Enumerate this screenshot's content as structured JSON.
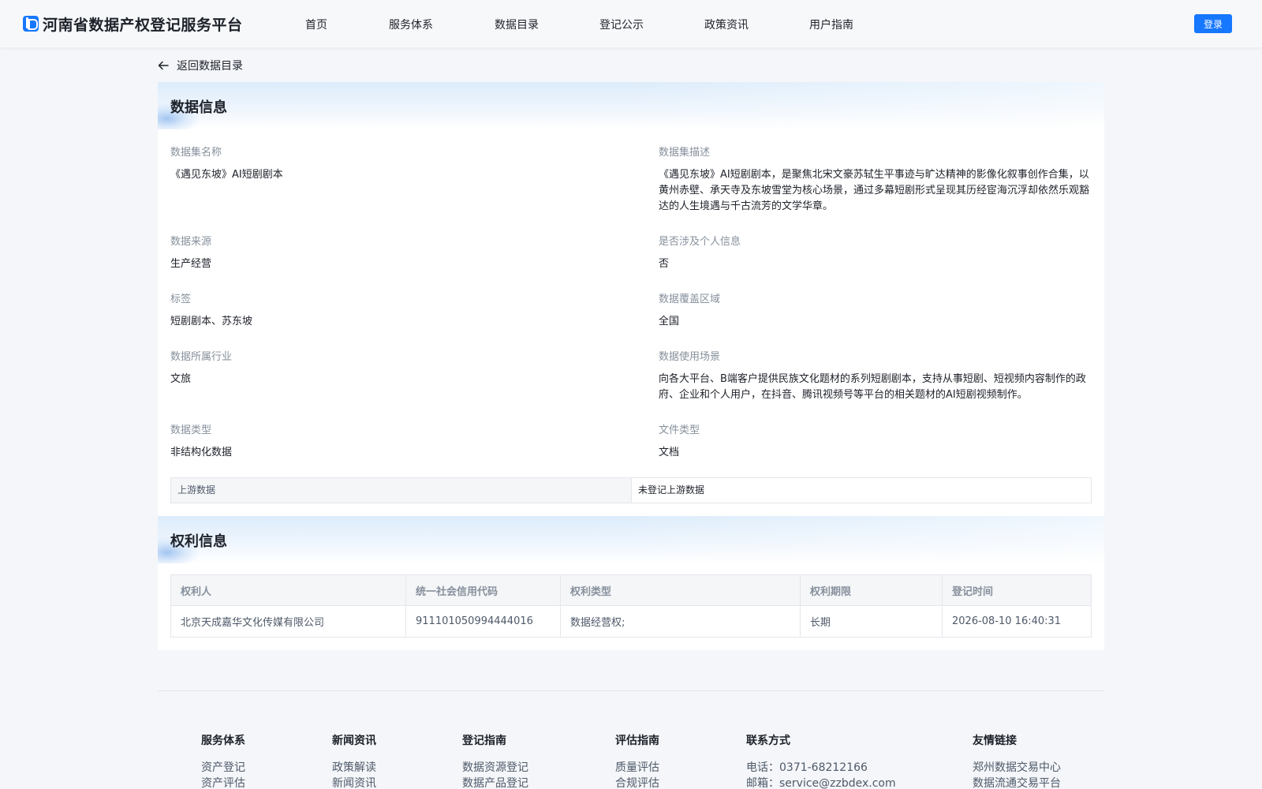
{
  "header": {
    "title": "河南省数据产权登记服务平台",
    "nav": [
      "首页",
      "服务体系",
      "数据目录",
      "登记公示",
      "政策资讯",
      "用户指南"
    ],
    "login": "登录",
    "accent": "#1677ff"
  },
  "back": {
    "label": "返回数据目录",
    "icon": "arrow-left-icon"
  },
  "data_info": {
    "title": "数据信息",
    "fields": [
      {
        "label": "数据集名称",
        "value": "《遇见东坡》AI短剧剧本"
      },
      {
        "label": "数据集描述",
        "value": "《遇见东坡》AI短剧剧本，是聚焦北宋文豪苏轼生平事迹与旷达精神的影像化叙事创作合集，以黄州赤壁、承天寺及东坡雪堂为核心场景，通过多幕短剧形式呈现其历经宦海沉浮却依然乐观豁达的人生境遇与千古流芳的文学华章。"
      },
      {
        "label": "数据来源",
        "value": "生产经营"
      },
      {
        "label": "是否涉及个人信息",
        "value": "否"
      },
      {
        "label": "标签",
        "value": "短剧剧本、苏东坡"
      },
      {
        "label": "数据覆盖区域",
        "value": "全国"
      },
      {
        "label": "数据所属行业",
        "value": "文旅"
      },
      {
        "label": "数据使用场景",
        "value": "向各大平台、B端客户提供民族文化题材的系列短剧剧本，支持从事短剧、短视频内容制作的政府、企业和个人用户，在抖音、腾讯视频号等平台的相关题材的AI短剧视频制作。"
      },
      {
        "label": "数据类型",
        "value": "非结构化数据"
      },
      {
        "label": "文件类型",
        "value": "文档"
      }
    ],
    "upstream": {
      "label": "上游数据",
      "value": "未登记上游数据"
    }
  },
  "rights_info": {
    "title": "权利信息",
    "columns": [
      "权利人",
      "统一社会信用代码",
      "权利类型",
      "权利期限",
      "登记时间"
    ],
    "rows": [
      [
        "北京天成嘉华文化传媒有限公司",
        "911101050994444016",
        "数据经营权;",
        "长期",
        "2026-08-10 16:40:31"
      ]
    ]
  },
  "footer": {
    "columns": [
      {
        "title": "服务体系",
        "items": [
          "资产登记",
          "资产评估"
        ]
      },
      {
        "title": "新闻资讯",
        "items": [
          "政策解读",
          "新闻资讯"
        ]
      },
      {
        "title": "登记指南",
        "items": [
          "数据资源登记",
          "数据产品登记"
        ]
      },
      {
        "title": "评估指南",
        "items": [
          "质量评估",
          "合规评估"
        ]
      },
      {
        "title": "联系方式",
        "items": [
          "电话：0371-68212166",
          "邮箱：service@zzbdex.com"
        ]
      },
      {
        "title": "友情链接",
        "items": [
          "郑州数据交易中心",
          "数据流通交易平台"
        ]
      }
    ]
  }
}
